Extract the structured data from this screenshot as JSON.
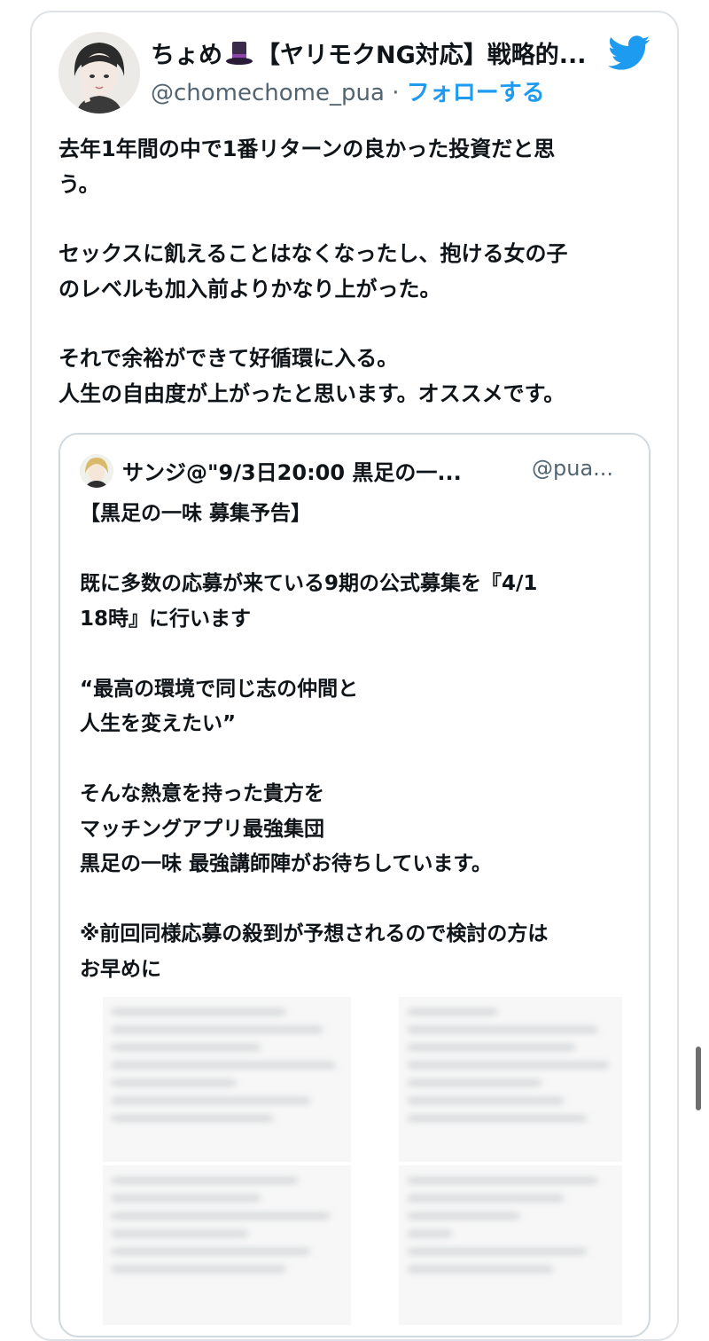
{
  "author": {
    "name_prefix": "ちょめ",
    "hat_emoji_icon": "top-hat-icon",
    "name_suffix": "【ヤリモクNG対応】戦略的...",
    "handle": "@chomechome_pua",
    "separator": "·",
    "follow_label": "フォローする"
  },
  "tweet": {
    "paragraphs": [
      [
        "去年1年間の中で1番リターンの良かった投資だと思",
        "う。"
      ],
      [
        "セックスに飢えることはなくなったし、抱ける女の子",
        "のレベルも加入前よりかなり上がった。"
      ],
      [
        "それで余裕ができて好循環に入る。",
        "人生の自由度が上がったと思います。オススメです。"
      ]
    ]
  },
  "quoted": {
    "name": "サンジ@\"9/3日20:00 黒足の一...",
    "handle": "@pua...",
    "paragraphs": [
      [
        "【黒足の一味 募集予告】"
      ],
      [
        "既に多数の応募が来ている9期の公式募集を『4/1",
        "18時』に行います"
      ],
      [
        "“最高の環境で同じ志の仲間と",
        "人生を変えたい”"
      ],
      [
        "そんな熱意を持った貴方を",
        "マッチングアプリ最強集団",
        "黒足の一味 最強講師陣がお待ちしています。"
      ],
      [
        "※前回同様応募の殺到が予想されるので検討の方は",
        "お早めに"
      ]
    ]
  },
  "icons": {
    "brand": "twitter-bird-icon",
    "brand_color": "#1d9bf0"
  }
}
